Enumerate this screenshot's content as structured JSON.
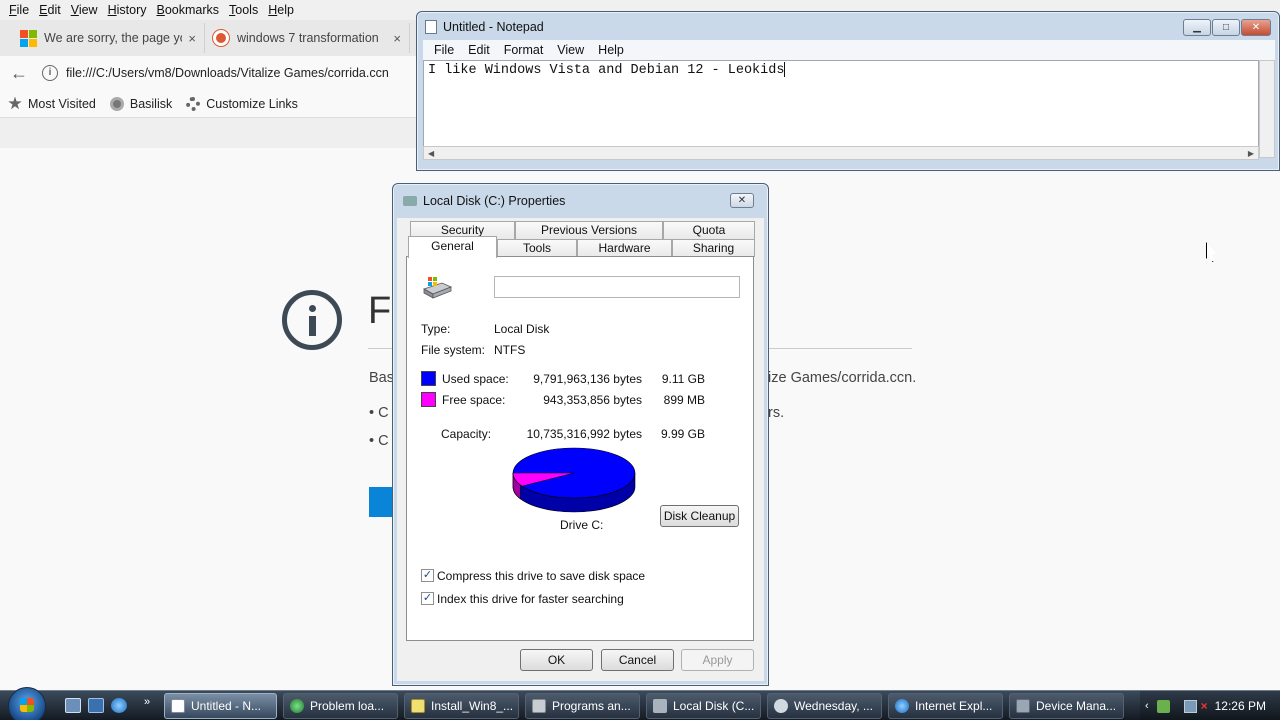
{
  "browser": {
    "menu": [
      "File",
      "Edit",
      "View",
      "History",
      "Bookmarks",
      "Tools",
      "Help"
    ],
    "tabs": [
      {
        "label": "We are sorry, the page you",
        "close": "×"
      },
      {
        "label": "windows 7 transformation",
        "close": "×"
      }
    ],
    "url": "file:///C:/Users/vm8/Downloads/Vitalize Games/corrida.ccn",
    "bookmarks": [
      "Most Visited",
      "Basilisk",
      "Customize Links"
    ],
    "error_title": "Fi",
    "error_line1_left": "Bas",
    "error_line1_right": "ize Games/corrida.ccn.",
    "bullet1_left": "• C",
    "bullet1_right": "rs.",
    "bullet2_left": "• C"
  },
  "notepad": {
    "title": "Untitled - Notepad",
    "menu": [
      "File",
      "Edit",
      "Format",
      "View",
      "Help"
    ],
    "text": "I like Windows Vista and Debian 12 - Leokids"
  },
  "props": {
    "title": "Local Disk (C:) Properties",
    "tabs_row1": [
      "Security",
      "Previous Versions",
      "Quota"
    ],
    "tabs_row2": [
      "General",
      "Tools",
      "Hardware",
      "Sharing"
    ],
    "type_label": "Type:",
    "type_value": "Local Disk",
    "fs_label": "File system:",
    "fs_value": "NTFS",
    "used_label": "Used space:",
    "used_bytes": "9,791,963,136 bytes",
    "used_human": "9.11 GB",
    "free_label": "Free space:",
    "free_bytes": "943,353,856 bytes",
    "free_human": "899 MB",
    "capacity_label": "Capacity:",
    "capacity_bytes": "10,735,316,992 bytes",
    "capacity_human": "9.99 GB",
    "drive_label": "Drive C:",
    "cleanup_btn": "Disk Cleanup",
    "compress_label": "Compress this drive to save disk space",
    "index_label": "Index this drive for faster searching",
    "ok": "OK",
    "cancel": "Cancel",
    "apply": "Apply",
    "colors": {
      "used": "#0000ff",
      "free": "#ff00ff"
    },
    "free_fraction": 0.0879
  },
  "taskbar": {
    "buttons": [
      "Untitled - N...",
      "Problem loa...",
      "Install_Win8_...",
      "Programs an...",
      "Local Disk (C...",
      "Wednesday, ...",
      "Internet Expl...",
      "Device Mana..."
    ],
    "clock": "12:26 PM"
  }
}
